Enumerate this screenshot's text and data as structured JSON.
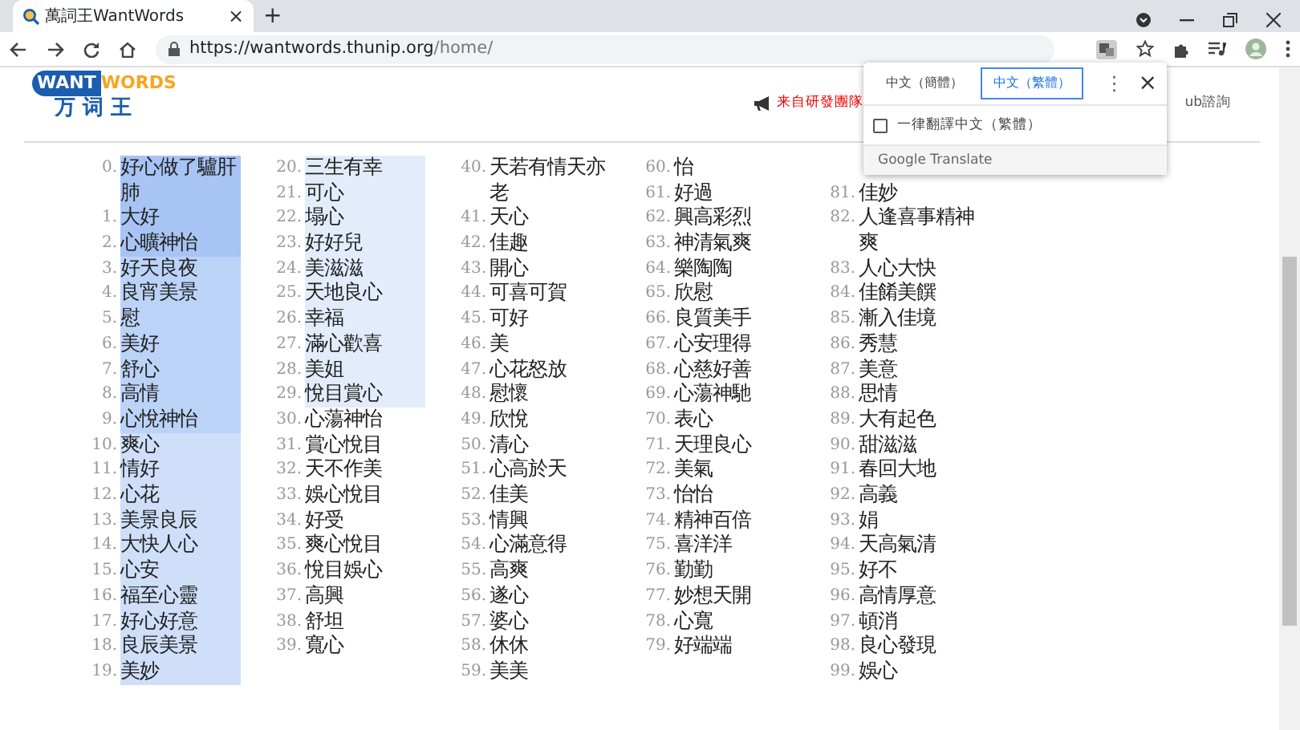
{
  "browser": {
    "tab_title": "萬詞王WantWords",
    "tab_close": "×",
    "new_tab": "+",
    "url_host": "https://wantwords.thunip.org",
    "url_path": "/home/"
  },
  "header": {
    "logo_left": "WANT",
    "logo_right": "WORDS",
    "logo_cn": "万 词 王",
    "announcement": "来自研發團隊",
    "link": "ub諮詢"
  },
  "translate_popup": {
    "languages": [
      {
        "label": "中文（簡體）",
        "selected": false
      },
      {
        "label": "中文（繁體）",
        "selected": true
      }
    ],
    "more": "⋮",
    "close": "×",
    "always": {
      "label": "一律翻譯中文（繁體）",
      "checked": false
    },
    "footer": "Google Translate"
  },
  "columns": [
    [
      {
        "number": "0.",
        "word": "好心做了驢肝肺",
        "color": "#a8c4f5"
      },
      {
        "number": "1.",
        "word": "大好",
        "color": "#a8c4f5"
      },
      {
        "number": "2.",
        "word": "心曠神怡",
        "color": "#a8c4f5"
      },
      {
        "number": "3.",
        "word": "好天良夜",
        "color": "#bcd3f8"
      },
      {
        "number": "4.",
        "word": "良宵美景",
        "color": "#bcd3f8"
      },
      {
        "number": "5.",
        "word": "慰",
        "color": "#bcd3f8"
      },
      {
        "number": "6.",
        "word": "美好",
        "color": "#bcd3f8"
      },
      {
        "number": "7.",
        "word": "舒心",
        "color": "#bcd3f8"
      },
      {
        "number": "8.",
        "word": "高情",
        "color": "#bcd3f8"
      },
      {
        "number": "9.",
        "word": "心悅神怡",
        "color": "#bcd3f8"
      },
      {
        "number": "10.",
        "word": "爽心",
        "color": "#cfdff9"
      },
      {
        "number": "11.",
        "word": "情好",
        "color": "#cfdff9"
      },
      {
        "number": "12.",
        "word": "心花",
        "color": "#cfdff9"
      },
      {
        "number": "13.",
        "word": "美景良辰",
        "color": "#cfdff9"
      },
      {
        "number": "14.",
        "word": "大快人心",
        "color": "#cfdff9"
      },
      {
        "number": "15.",
        "word": "心安",
        "color": "#cfdff9"
      },
      {
        "number": "16.",
        "word": "福至心靈",
        "color": "#cfdff9"
      },
      {
        "number": "17.",
        "word": "好心好意",
        "color": "#cfdff9"
      },
      {
        "number": "18.",
        "word": "良辰美景",
        "color": "#cfdff9"
      },
      {
        "number": "19.",
        "word": "美妙",
        "color": "#cfdff9"
      }
    ],
    [
      {
        "number": "20.",
        "word": "三生有幸",
        "color": "#e3ecfb"
      },
      {
        "number": "21.",
        "word": "可心",
        "color": "#e3ecfb"
      },
      {
        "number": "22.",
        "word": "塌心",
        "color": "#e3ecfb"
      },
      {
        "number": "23.",
        "word": "好好兒",
        "color": "#e3ecfb"
      },
      {
        "number": "24.",
        "word": "美滋滋",
        "color": "#e3ecfb"
      },
      {
        "number": "25.",
        "word": "天地良心",
        "color": "#e3ecfb"
      },
      {
        "number": "26.",
        "word": "幸福",
        "color": "#e3ecfb"
      },
      {
        "number": "27.",
        "word": "滿心歡喜",
        "color": "#e3ecfb"
      },
      {
        "number": "28.",
        "word": "美姐",
        "color": "#e3ecfb"
      },
      {
        "number": "29.",
        "word": "悅目賞心",
        "color": "#e3ecfb"
      },
      {
        "number": "30.",
        "word": "心蕩神怡"
      },
      {
        "number": "31.",
        "word": "賞心悅目"
      },
      {
        "number": "32.",
        "word": "天不作美"
      },
      {
        "number": "33.",
        "word": "娛心悅目"
      },
      {
        "number": "34.",
        "word": "好受"
      },
      {
        "number": "35.",
        "word": "爽心悅目"
      },
      {
        "number": "36.",
        "word": "悅目娛心"
      },
      {
        "number": "37.",
        "word": "高興"
      },
      {
        "number": "38.",
        "word": "舒坦"
      },
      {
        "number": "39.",
        "word": "寬心"
      }
    ],
    [
      {
        "number": "40.",
        "word": "天若有情天亦老"
      },
      {
        "number": "41.",
        "word": "天心"
      },
      {
        "number": "42.",
        "word": "佳趣"
      },
      {
        "number": "43.",
        "word": "開心"
      },
      {
        "number": "44.",
        "word": "可喜可賀"
      },
      {
        "number": "45.",
        "word": "可好"
      },
      {
        "number": "46.",
        "word": "美"
      },
      {
        "number": "47.",
        "word": "心花怒放"
      },
      {
        "number": "48.",
        "word": "慰懷"
      },
      {
        "number": "49.",
        "word": "欣悅"
      },
      {
        "number": "50.",
        "word": "清心"
      },
      {
        "number": "51.",
        "word": "心高於天"
      },
      {
        "number": "52.",
        "word": "佳美"
      },
      {
        "number": "53.",
        "word": "情興"
      },
      {
        "number": "54.",
        "word": "心滿意得"
      },
      {
        "number": "55.",
        "word": "高爽"
      },
      {
        "number": "56.",
        "word": "遂心"
      },
      {
        "number": "57.",
        "word": "婆心"
      },
      {
        "number": "58.",
        "word": "休休"
      },
      {
        "number": "59.",
        "word": "美美"
      }
    ],
    [
      {
        "number": "60.",
        "word": "怡"
      },
      {
        "number": "61.",
        "word": "好過"
      },
      {
        "number": "62.",
        "word": "興高彩烈"
      },
      {
        "number": "63.",
        "word": "神清氣爽"
      },
      {
        "number": "64.",
        "word": "樂陶陶"
      },
      {
        "number": "65.",
        "word": "欣慰"
      },
      {
        "number": "66.",
        "word": "良質美手"
      },
      {
        "number": "67.",
        "word": "心安理得"
      },
      {
        "number": "68.",
        "word": "心慈好善"
      },
      {
        "number": "69.",
        "word": "心蕩神馳"
      },
      {
        "number": "70.",
        "word": "表心"
      },
      {
        "number": "71.",
        "word": "天理良心"
      },
      {
        "number": "72.",
        "word": "美氣"
      },
      {
        "number": "73.",
        "word": "怡怡"
      },
      {
        "number": "74.",
        "word": "精神百倍"
      },
      {
        "number": "75.",
        "word": "喜洋洋"
      },
      {
        "number": "76.",
        "word": "勤勤"
      },
      {
        "number": "77.",
        "word": "妙想天開"
      },
      {
        "number": "78.",
        "word": "心寬"
      },
      {
        "number": "79.",
        "word": "好端端"
      }
    ],
    [
      {
        "number": "81.",
        "word": "佳妙"
      },
      {
        "number": "82.",
        "word": "人逢喜事精神爽"
      },
      {
        "number": "83.",
        "word": "人心大快"
      },
      {
        "number": "84.",
        "word": "佳餚美饌"
      },
      {
        "number": "85.",
        "word": "漸入佳境"
      },
      {
        "number": "86.",
        "word": "秀慧"
      },
      {
        "number": "87.",
        "word": "美意"
      },
      {
        "number": "88.",
        "word": "思情"
      },
      {
        "number": "89.",
        "word": "大有起色"
      },
      {
        "number": "90.",
        "word": "甜滋滋"
      },
      {
        "number": "91.",
        "word": "春回大地"
      },
      {
        "number": "92.",
        "word": "高義"
      },
      {
        "number": "93.",
        "word": "娟"
      },
      {
        "number": "94.",
        "word": "天高氣清"
      },
      {
        "number": "95.",
        "word": "好不"
      },
      {
        "number": "96.",
        "word": "高情厚意"
      },
      {
        "number": "97.",
        "word": "頓消"
      },
      {
        "number": "98.",
        "word": "良心發現"
      },
      {
        "number": "99.",
        "word": "娛心"
      }
    ]
  ]
}
